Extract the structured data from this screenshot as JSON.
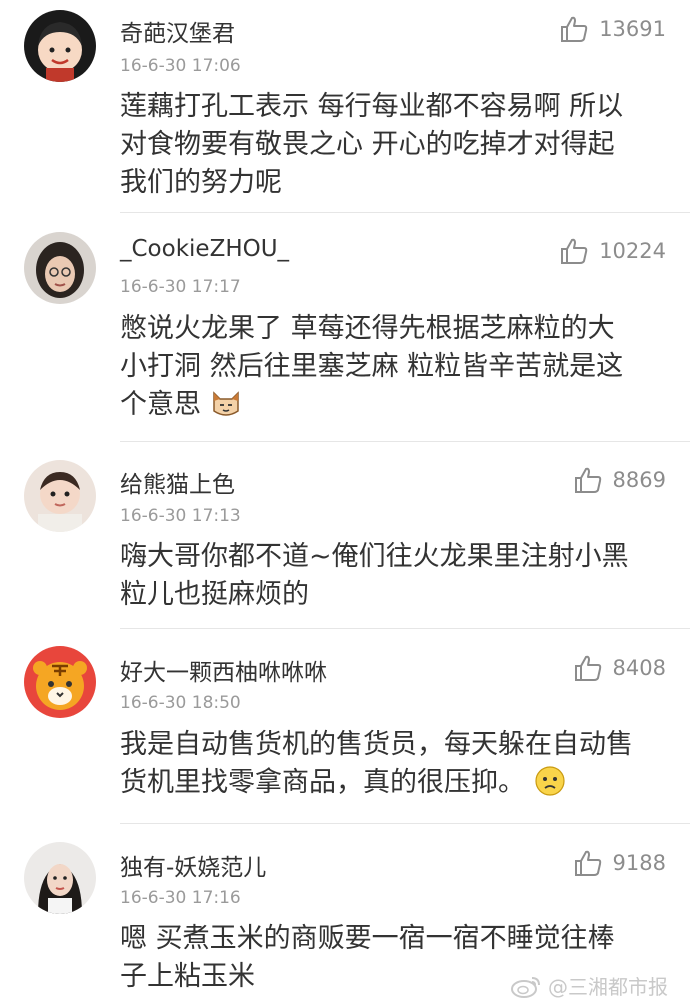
{
  "comments": [
    {
      "username": "奇葩汉堡君",
      "time": "16-6-30 17:06",
      "likes": "13691",
      "text_lines": [
        "莲藕打孔工表示  每行每业都不容易啊  所以",
        "对食物要有敬畏之心  开心的吃掉才对得起",
        "我们的努力呢"
      ],
      "avatar_icon": "cartoon-boy-avatar"
    },
    {
      "username": "_CookieZHOU_",
      "time": "16-6-30 17:17",
      "likes": "10224",
      "text_lines": [
        "憋说火龙果了 草莓还得先根据芝麻粒的大",
        "小打洞 然后往里塞芝麻 粒粒皆辛苦就是这",
        "个意思"
      ],
      "avatar_icon": "woman-glasses-avatar"
    },
    {
      "username": "给熊猫上色",
      "time": "16-6-30 17:13",
      "likes": "8869",
      "text_lines": [
        "嗨大哥你都不道~俺们往火龙果里注射小黑",
        "粒儿也挺麻烦的"
      ],
      "avatar_icon": "baby-photo-avatar"
    },
    {
      "username": "好大一颗西柚咻咻咻",
      "time": "16-6-30 18:50",
      "likes": "8408",
      "text_lines": [
        "我是自动售货机的售货员，每天躲在自动售",
        "货机里找零拿商品，真的很压抑。"
      ],
      "avatar_icon": "tiger-avatar"
    },
    {
      "username": "独有-妖娆范儿",
      "time": "16-6-30 17:16",
      "likes": "9188",
      "text_lines": [
        "嗯   买煮玉米的商贩要一宿一宿不睡觉往棒",
        "子上粘玉米"
      ],
      "avatar_icon": "woman-portrait-avatar"
    }
  ],
  "watermark": "@三湘都市报",
  "colors": {
    "text": "#333333",
    "meta": "#9a9a9a",
    "divider": "#e6e6e6",
    "like": "#8c8c8c"
  }
}
